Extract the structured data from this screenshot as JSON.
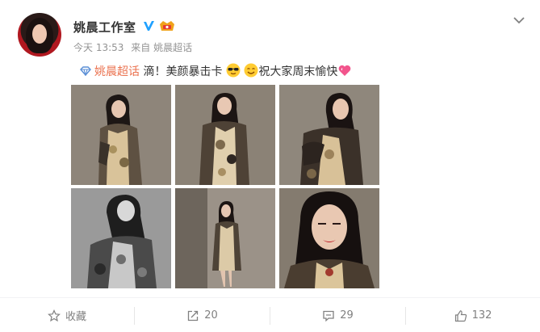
{
  "post": {
    "author": "姚晨工作室",
    "time": "今天 13:53",
    "source_prefix": "来自",
    "source": "姚晨超话",
    "topic": "姚晨超话",
    "text_part1": "滴！美颜暴击卡",
    "text_part2": "祝大家周末愉快"
  },
  "icons": {
    "verified": "verified-v-icon",
    "badge": "fan-badge-icon",
    "topic": "super-topic-icon",
    "emoji1": "cool-sunglasses-emoji",
    "emoji2": "smile-emoji",
    "emoji3": "heart-emoji"
  },
  "actions": {
    "favorite_label": "收藏",
    "repost_count": "20",
    "comment_count": "29",
    "like_count": "132"
  },
  "colors": {
    "topic": "#eb7350",
    "verified": "#1fa0ff",
    "badge": "#f0a21a"
  }
}
